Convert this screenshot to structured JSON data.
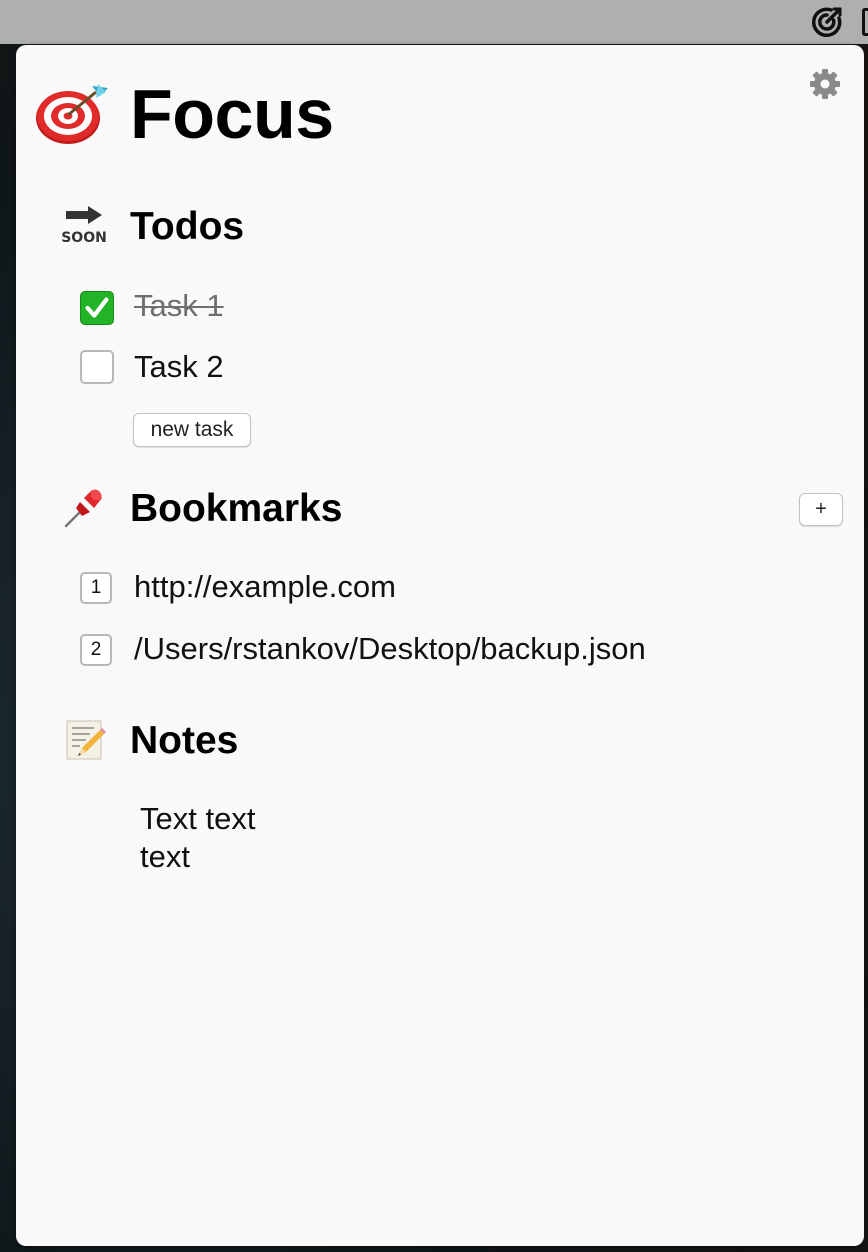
{
  "menubar": {
    "icon": "focus-target-icon"
  },
  "app": {
    "title": "Focus",
    "logo_icon": "dart-target-icon",
    "settings_icon": "gear-icon"
  },
  "todos": {
    "title": "Todos",
    "icon": "soon-arrow-icon",
    "icon_text": "SOON",
    "items": [
      {
        "label": "Task 1",
        "done": true
      },
      {
        "label": "Task 2",
        "done": false
      }
    ],
    "new_task_label": "new task"
  },
  "bookmarks": {
    "title": "Bookmarks",
    "icon": "pushpin-icon",
    "add_label": "+",
    "items": [
      {
        "index": "1",
        "label": "http://example.com"
      },
      {
        "index": "2",
        "label": "/Users/rstankov/Desktop/backup.json"
      }
    ]
  },
  "notes": {
    "title": "Notes",
    "icon": "memo-icon",
    "lines": [
      "Text text",
      "text"
    ]
  },
  "colors": {
    "checked_green": "#22b326",
    "panel_bg": "#f9f9f9",
    "menubar_bg": "#aeb0b0"
  }
}
